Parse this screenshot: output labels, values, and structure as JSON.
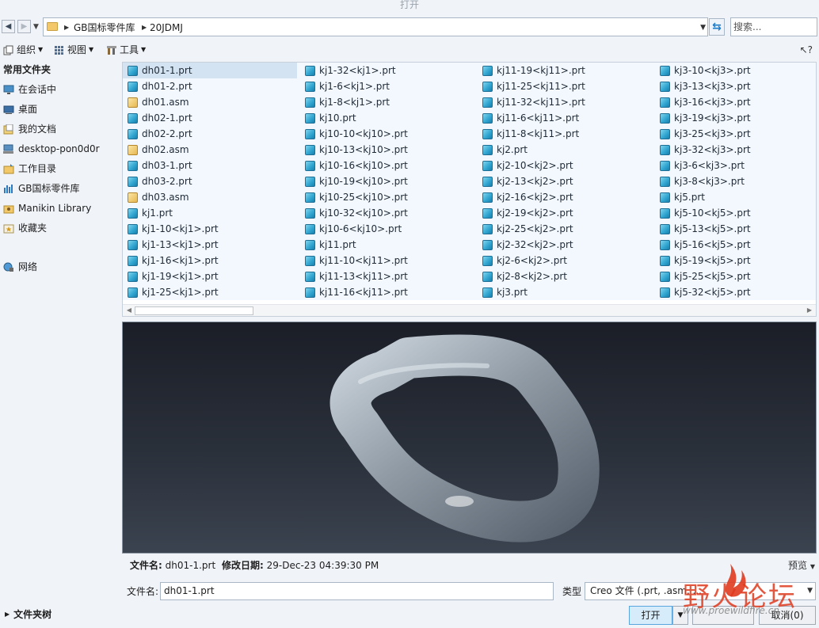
{
  "window": {
    "title": "打开"
  },
  "address": {
    "crumbs": [
      "GB国标零件库",
      "20JDMJ"
    ],
    "search_placeholder": "搜索..."
  },
  "toolbar": {
    "organize": "组织",
    "views": "视图",
    "tools": "工具",
    "help": "?"
  },
  "sidebar": {
    "heading": "常用文件夹",
    "items": [
      {
        "label": "在会话中",
        "icon": "monitor-icon"
      },
      {
        "label": "桌面",
        "icon": "desktop-icon"
      },
      {
        "label": "我的文档",
        "icon": "documents-icon"
      },
      {
        "label": "desktop-pon0d0r",
        "icon": "computer-icon"
      },
      {
        "label": "工作目录",
        "icon": "working-dir-icon"
      },
      {
        "label": "GB国标零件库",
        "icon": "library-icon"
      },
      {
        "label": "Manikin Library",
        "icon": "manikin-library-icon"
      },
      {
        "label": "收藏夹",
        "icon": "favorites-icon"
      }
    ],
    "network": "网络"
  },
  "files": {
    "columns": [
      [
        {
          "name": "dh01-1.prt",
          "type": "prt"
        },
        {
          "name": "dh01-2.prt",
          "type": "prt"
        },
        {
          "name": "dh01.asm",
          "type": "asm"
        },
        {
          "name": "dh02-1.prt",
          "type": "prt"
        },
        {
          "name": "dh02-2.prt",
          "type": "prt"
        },
        {
          "name": "dh02.asm",
          "type": "asm"
        },
        {
          "name": "dh03-1.prt",
          "type": "prt"
        },
        {
          "name": "dh03-2.prt",
          "type": "prt"
        },
        {
          "name": "dh03.asm",
          "type": "asm"
        },
        {
          "name": "kj1.prt",
          "type": "prt"
        },
        {
          "name": "kj1-10<kj1>.prt",
          "type": "prt"
        },
        {
          "name": "kj1-13<kj1>.prt",
          "type": "prt"
        },
        {
          "name": "kj1-16<kj1>.prt",
          "type": "prt"
        },
        {
          "name": "kj1-19<kj1>.prt",
          "type": "prt"
        },
        {
          "name": "kj1-25<kj1>.prt",
          "type": "prt"
        }
      ],
      [
        {
          "name": "kj1-32<kj1>.prt",
          "type": "prt"
        },
        {
          "name": "kj1-6<kj1>.prt",
          "type": "prt"
        },
        {
          "name": "kj1-8<kj1>.prt",
          "type": "prt"
        },
        {
          "name": "kj10.prt",
          "type": "prt"
        },
        {
          "name": "kj10-10<kj10>.prt",
          "type": "prt"
        },
        {
          "name": "kj10-13<kj10>.prt",
          "type": "prt"
        },
        {
          "name": "kj10-16<kj10>.prt",
          "type": "prt"
        },
        {
          "name": "kj10-19<kj10>.prt",
          "type": "prt"
        },
        {
          "name": "kj10-25<kj10>.prt",
          "type": "prt"
        },
        {
          "name": "kj10-32<kj10>.prt",
          "type": "prt"
        },
        {
          "name": "kj10-6<kj10>.prt",
          "type": "prt"
        },
        {
          "name": "kj11.prt",
          "type": "prt"
        },
        {
          "name": "kj11-10<kj11>.prt",
          "type": "prt"
        },
        {
          "name": "kj11-13<kj11>.prt",
          "type": "prt"
        },
        {
          "name": "kj11-16<kj11>.prt",
          "type": "prt"
        }
      ],
      [
        {
          "name": "kj11-19<kj11>.prt",
          "type": "prt"
        },
        {
          "name": "kj11-25<kj11>.prt",
          "type": "prt"
        },
        {
          "name": "kj11-32<kj11>.prt",
          "type": "prt"
        },
        {
          "name": "kj11-6<kj11>.prt",
          "type": "prt"
        },
        {
          "name": "kj11-8<kj11>.prt",
          "type": "prt"
        },
        {
          "name": "kj2.prt",
          "type": "prt"
        },
        {
          "name": "kj2-10<kj2>.prt",
          "type": "prt"
        },
        {
          "name": "kj2-13<kj2>.prt",
          "type": "prt"
        },
        {
          "name": "kj2-16<kj2>.prt",
          "type": "prt"
        },
        {
          "name": "kj2-19<kj2>.prt",
          "type": "prt"
        },
        {
          "name": "kj2-25<kj2>.prt",
          "type": "prt"
        },
        {
          "name": "kj2-32<kj2>.prt",
          "type": "prt"
        },
        {
          "name": "kj2-6<kj2>.prt",
          "type": "prt"
        },
        {
          "name": "kj2-8<kj2>.prt",
          "type": "prt"
        },
        {
          "name": "kj3.prt",
          "type": "prt"
        }
      ],
      [
        {
          "name": "kj3-10<kj3>.prt",
          "type": "prt"
        },
        {
          "name": "kj3-13<kj3>.prt",
          "type": "prt"
        },
        {
          "name": "kj3-16<kj3>.prt",
          "type": "prt"
        },
        {
          "name": "kj3-19<kj3>.prt",
          "type": "prt"
        },
        {
          "name": "kj3-25<kj3>.prt",
          "type": "prt"
        },
        {
          "name": "kj3-32<kj3>.prt",
          "type": "prt"
        },
        {
          "name": "kj3-6<kj3>.prt",
          "type": "prt"
        },
        {
          "name": "kj3-8<kj3>.prt",
          "type": "prt"
        },
        {
          "name": "kj5.prt",
          "type": "prt"
        },
        {
          "name": "kj5-10<kj5>.prt",
          "type": "prt"
        },
        {
          "name": "kj5-13<kj5>.prt",
          "type": "prt"
        },
        {
          "name": "kj5-16<kj5>.prt",
          "type": "prt"
        },
        {
          "name": "kj5-19<kj5>.prt",
          "type": "prt"
        },
        {
          "name": "kj5-25<kj5>.prt",
          "type": "prt"
        },
        {
          "name": "kj5-32<kj5>.prt",
          "type": "prt"
        }
      ]
    ],
    "selected": "dh01-1.prt"
  },
  "info": {
    "filename_label": "文件名:",
    "filename": "dh01-1.prt",
    "modified_label": "修改日期:",
    "modified": "29-Dec-23 04:39:30 PM",
    "preview_label": "预览"
  },
  "form": {
    "filename_label": "文件名:",
    "filename_value": "dh01-1.prt",
    "type_label": "类型",
    "type_value": "Creo 文件 (.prt, .asm, ..."
  },
  "footer": {
    "folder_tree": "文件夹树",
    "open": "打开",
    "cancel": "取消(0)"
  },
  "watermark": {
    "text": "野火论坛",
    "url": "www.proewildfire.cn"
  },
  "colors": {
    "selection": "#d4e3f1",
    "prt_icon": "#2fa3cf",
    "asm_icon": "#e7b84f",
    "preview_bg": "#1f232c",
    "watermark": "#e03a1e"
  }
}
